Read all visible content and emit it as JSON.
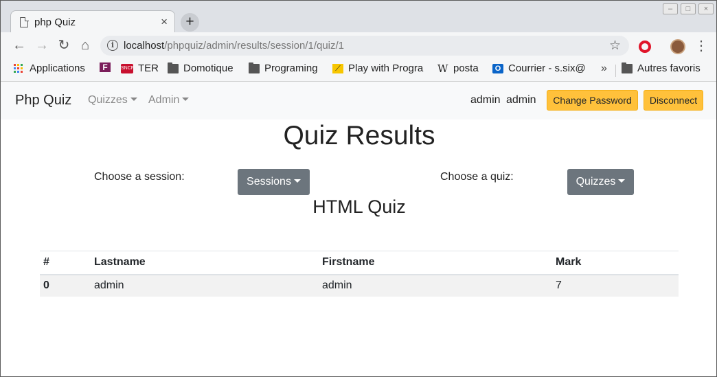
{
  "browser": {
    "tab_title": "php Quiz",
    "tab_close": "×",
    "new_tab": "+",
    "url_host": "localhost",
    "url_path": "/phpquiz/admin/results/session/1/quiz/1",
    "bookmarks": [
      {
        "label": "Applications",
        "icon": "apps-grid-icon"
      },
      {
        "label": "",
        "icon": "f-logo-icon"
      },
      {
        "label": "TER",
        "icon": "sncf-icon"
      },
      {
        "label": "Domotique",
        "icon": "folder-icon"
      },
      {
        "label": "Programing",
        "icon": "folder-icon"
      },
      {
        "label": "Play with Progra",
        "icon": "play-icon"
      },
      {
        "label": "posta",
        "icon": "wikipedia-icon"
      },
      {
        "label": "Courrier - s.six@",
        "icon": "outlook-icon"
      },
      {
        "label": "Autres favoris",
        "icon": "folder-icon"
      }
    ],
    "bookmarks_overflow": "»"
  },
  "navbar": {
    "brand": "Php Quiz",
    "quizzes_menu": "Quizzes",
    "admin_menu": "Admin",
    "user_lastname": "admin",
    "user_firstname": "admin",
    "change_password": "Change Password",
    "disconnect": "Disconnect"
  },
  "main": {
    "title": "Quiz Results",
    "session_label": "Choose a session:",
    "session_button": "Sessions",
    "quiz_label": "Choose a quiz:",
    "quiz_button": "Quizzes",
    "quiz_name": "HTML Quiz"
  },
  "table": {
    "headers": [
      "#",
      "Lastname",
      "Firstname",
      "Mark"
    ],
    "rows": [
      [
        "0",
        "admin",
        "admin",
        "7"
      ]
    ]
  },
  "colors": {
    "warning": "#ffc13b",
    "secondary": "#6c757d",
    "navbar_bg": "#f8f9fa"
  }
}
